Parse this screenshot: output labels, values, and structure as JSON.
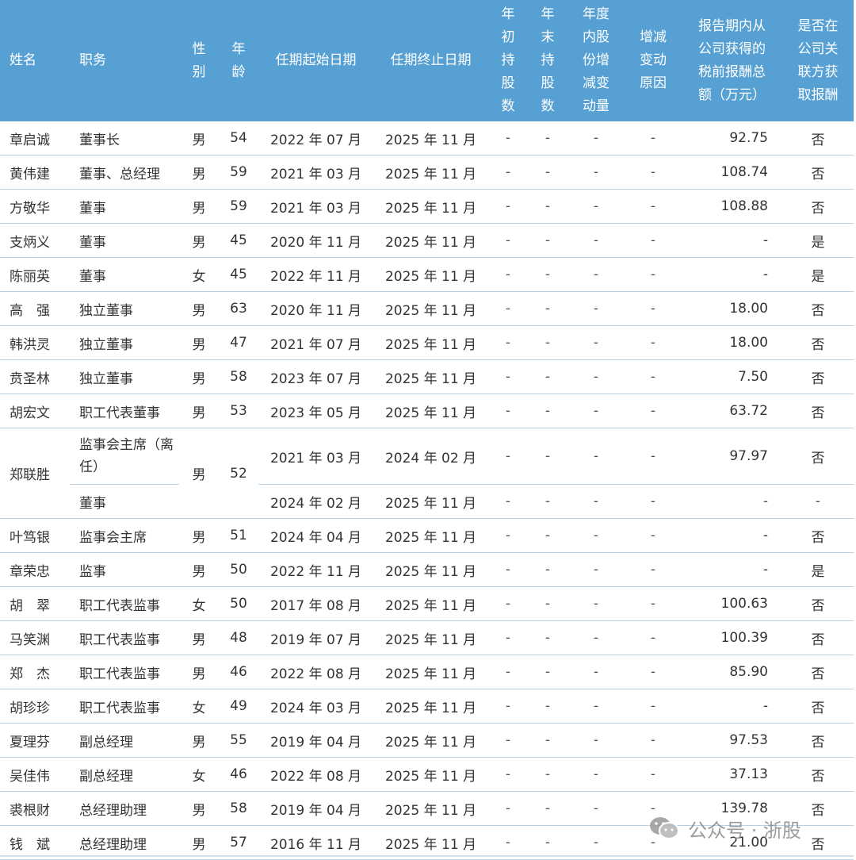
{
  "headers": {
    "name": "姓名",
    "title": "职务",
    "gender": "性别",
    "age": "年龄",
    "start": "任期起始日期",
    "end": "任期终止日期",
    "shares_start": "年初持股数",
    "shares_end": "年末持股数",
    "shares_change": "年度内股份增减变动量",
    "change_reason": "增减变动原因",
    "pay": "报告期内从公司获得的税前报酬总额（万元）",
    "related_pay": "是否在公司关联方获取报酬"
  },
  "header_lines": {
    "gender": [
      "性",
      "别"
    ],
    "age": [
      "年",
      "龄"
    ],
    "shares_start": [
      "年",
      "初",
      "持",
      "股",
      "数"
    ],
    "shares_end": [
      "年",
      "末",
      "持",
      "股",
      "数"
    ],
    "shares_change": [
      "年度",
      "内股",
      "份增",
      "减变",
      "动量"
    ],
    "change_reason": [
      "增减",
      "变动",
      "原因"
    ],
    "pay": [
      "报告期内从",
      "公司获得的",
      "税前报酬总",
      "额（万元）"
    ],
    "related_pay": [
      "是否在",
      "公司关",
      "联方获",
      "取报酬"
    ]
  },
  "dash": "-",
  "rows": [
    {
      "name": "章启诚",
      "title": "董事长",
      "gender": "男",
      "age": "54",
      "start": "2022 年 07 月",
      "end": "2025 年 11 月",
      "pay": "92.75",
      "related": "否"
    },
    {
      "name": "黄伟建",
      "title": "董事、总经理",
      "gender": "男",
      "age": "59",
      "start": "2021 年 03 月",
      "end": "2025 年 11 月",
      "pay": "108.74",
      "related": "否"
    },
    {
      "name": "方敬华",
      "title": "董事",
      "gender": "男",
      "age": "59",
      "start": "2021 年 03 月",
      "end": "2025 年 11 月",
      "pay": "108.88",
      "related": "否"
    },
    {
      "name": "支炳义",
      "title": "董事",
      "gender": "男",
      "age": "45",
      "start": "2020 年 11 月",
      "end": "2025 年 11 月",
      "pay": "-",
      "related": "是"
    },
    {
      "name": "陈丽英",
      "title": "董事",
      "gender": "女",
      "age": "45",
      "start": "2022 年 11 月",
      "end": "2025 年 11 月",
      "pay": "-",
      "related": "是"
    },
    {
      "name": "高　强",
      "title": "独立董事",
      "gender": "男",
      "age": "63",
      "start": "2020 年 11 月",
      "end": "2025 年 11 月",
      "pay": "18.00",
      "related": "否"
    },
    {
      "name": "韩洪灵",
      "title": "独立董事",
      "gender": "男",
      "age": "47",
      "start": "2021 年 07 月",
      "end": "2025 年 11 月",
      "pay": "18.00",
      "related": "否"
    },
    {
      "name": "贲圣林",
      "title": "独立董事",
      "gender": "男",
      "age": "58",
      "start": "2023 年 07 月",
      "end": "2025 年 11 月",
      "pay": "7.50",
      "related": "否"
    },
    {
      "name": "胡宏文",
      "title": "职工代表董事",
      "gender": "男",
      "age": "53",
      "start": "2023 年 05 月",
      "end": "2025 年 11 月",
      "pay": "63.72",
      "related": "否"
    }
  ],
  "merged": {
    "name": "郑联胜",
    "gender": "男",
    "age": "52",
    "sub1": {
      "title": "监事会主席（离任）",
      "start": "2021 年 03 月",
      "end": "2024 年 02 月",
      "pay": "97.97",
      "related": "否"
    },
    "sub2": {
      "title": "董事",
      "start": "2024 年 02 月",
      "end": "2025 年 11 月",
      "pay": "-",
      "related": "-"
    }
  },
  "rows2": [
    {
      "name": "叶笃银",
      "title": "监事会主席",
      "gender": "男",
      "age": "51",
      "start": "2024 年 04 月",
      "end": "2025 年 11 月",
      "pay": "-",
      "related": "否"
    },
    {
      "name": "章荣忠",
      "title": "监事",
      "gender": "男",
      "age": "50",
      "start": "2022 年 11 月",
      "end": "2025 年 11 月",
      "pay": "-",
      "related": "是"
    },
    {
      "name": "胡　翠",
      "title": "职工代表监事",
      "gender": "女",
      "age": "50",
      "start": "2017 年 08 月",
      "end": "2025 年 11 月",
      "pay": "100.63",
      "related": "否"
    },
    {
      "name": "马笑渊",
      "title": "职工代表监事",
      "gender": "男",
      "age": "48",
      "start": "2019 年 07 月",
      "end": "2025 年 11 月",
      "pay": "100.39",
      "related": "否"
    },
    {
      "name": "郑　杰",
      "title": "职工代表监事",
      "gender": "男",
      "age": "46",
      "start": "2022 年 08 月",
      "end": "2025 年 11 月",
      "pay": "85.90",
      "related": "否"
    },
    {
      "name": "胡珍珍",
      "title": "职工代表监事",
      "gender": "女",
      "age": "49",
      "start": "2024 年 03 月",
      "end": "2025 年 11 月",
      "pay": "-",
      "related": "否"
    },
    {
      "name": "夏理芬",
      "title": "副总经理",
      "gender": "男",
      "age": "55",
      "start": "2019 年 04 月",
      "end": "2025 年 11 月",
      "pay": "97.53",
      "related": "否"
    },
    {
      "name": "吴佳伟",
      "title": "副总经理",
      "gender": "女",
      "age": "46",
      "start": "2022 年 08 月",
      "end": "2025 年 11 月",
      "pay": "37.13",
      "related": "否"
    },
    {
      "name": "裘根财",
      "title": "总经理助理",
      "gender": "男",
      "age": "58",
      "start": "2019 年 04 月",
      "end": "2025 年 11 月",
      "pay": "139.78",
      "related": "否"
    },
    {
      "name": "钱　斌",
      "title": "总经理助理",
      "gender": "男",
      "age": "57",
      "start": "2016 年 11 月",
      "end": "2025 年 11 月",
      "pay": "21.00",
      "related": "否"
    }
  ],
  "watermark": "公众号 · 浙股",
  "colors": {
    "header_bg": "#56a0d3",
    "row_line": "#b7d1e6"
  }
}
